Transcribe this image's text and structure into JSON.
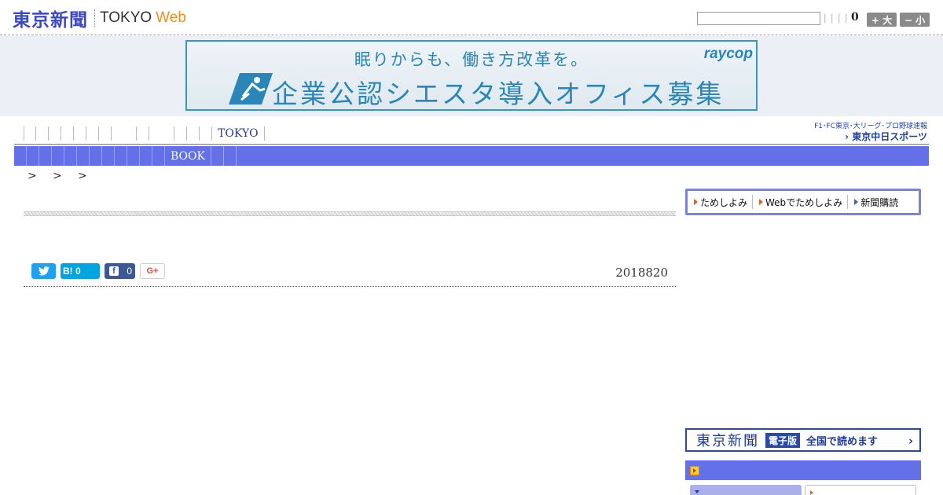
{
  "header": {
    "logo_jp": "東京新聞",
    "logo_tokyo": "TOKYO",
    "logo_web": "Web",
    "search_value": "",
    "pipes": "| | | |",
    "counter": "0",
    "size_up_label": "+ 大",
    "size_down_label": "− 小"
  },
  "ad": {
    "line1": "眠りからも、働き方改革を。",
    "line2": "企業公認シエスタ導入オフィス募集",
    "brand": "raycop"
  },
  "nav_top": {
    "items": [
      "",
      "",
      "",
      "",
      "",
      "",
      "",
      "",
      "",
      "",
      "",
      "",
      "",
      "TOKYO"
    ]
  },
  "chunichi": {
    "caption": "F1･FC東京･大リーグ･プロ野球速報",
    "name": "› 東京中日スポーツ"
  },
  "nav_bar": {
    "items": [
      "",
      "",
      "",
      "",
      "",
      "",
      "",
      "",
      "",
      "",
      "",
      "",
      "BOOK",
      "",
      ""
    ]
  },
  "breadcrumb": {
    "separators": [
      ">",
      ">",
      ">"
    ]
  },
  "share": {
    "twitter_label": "",
    "hatena_label": "B! 0",
    "facebook_label": "f",
    "facebook_count": "0",
    "gplus_label": "G+"
  },
  "article": {
    "date": "2018820"
  },
  "sidebar": {
    "tameshi_items": [
      "ためしよみ",
      "Webでためしよみ",
      "新聞購読"
    ],
    "e_edition": {
      "logo": "東京新聞",
      "badge": "電子版",
      "text": "全国で読めます",
      "arrow": "›"
    }
  },
  "colors": {
    "nav_bar": "#6470e8",
    "logo_blue": "#3b47c4",
    "web_orange": "#f08c1e",
    "ad_blue": "#2a86b8"
  }
}
